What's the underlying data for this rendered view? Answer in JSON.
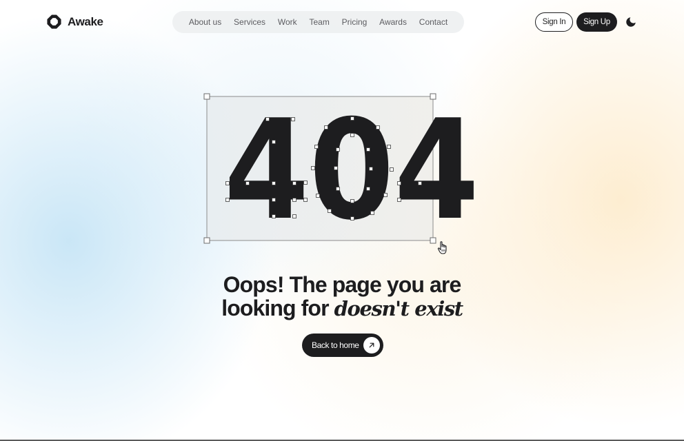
{
  "brand": {
    "name": "Awake",
    "logo_icon": "hexagon-ring-icon"
  },
  "nav": {
    "items": [
      {
        "label": "About us"
      },
      {
        "label": "Services"
      },
      {
        "label": "Work"
      },
      {
        "label": "Team"
      },
      {
        "label": "Pricing"
      },
      {
        "label": "Awards"
      },
      {
        "label": "Contact"
      }
    ]
  },
  "auth": {
    "sign_in": "Sign In",
    "sign_up": "Sign Up"
  },
  "theme_toggle": {
    "icon": "moon-icon"
  },
  "error": {
    "code": "404",
    "headline_line1": "Oops! The page you are",
    "headline_line2_prefix": "looking for",
    "headline_line2_italic": "doesn't exist"
  },
  "cta": {
    "label": "Back to home",
    "icon": "arrow-up-right-icon"
  },
  "colors": {
    "text": "#1d1d1f",
    "nav_bg": "#eceef0",
    "nav_text": "#5c5c60",
    "glow_blue": "#c7e5f6",
    "glow_peach": "#fdecce"
  }
}
